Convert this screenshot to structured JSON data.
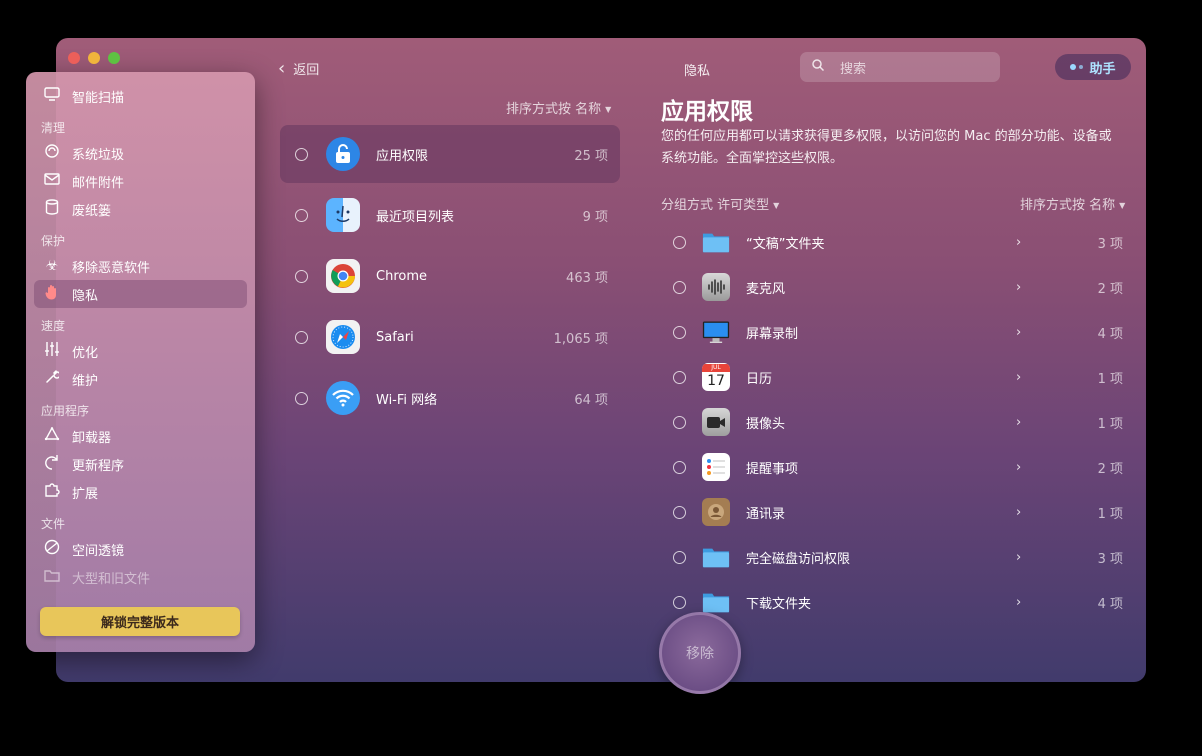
{
  "window": {
    "title": "隐私"
  },
  "header": {
    "back_label": "返回",
    "search_placeholder": "搜索",
    "assistant_label": "助手"
  },
  "sidebar": {
    "smart_scan": "智能扫描",
    "sections": {
      "cleanup": "清理",
      "protection": "保护",
      "speed": "速度",
      "applications": "应用程序",
      "files": "文件"
    },
    "items": {
      "system_junk": "系统垃圾",
      "mail_attachments": "邮件附件",
      "trash_bins": "废纸篓",
      "malware_removal": "移除恶意软件",
      "privacy": "隐私",
      "optimization": "优化",
      "maintenance": "维护",
      "uninstaller": "卸载器",
      "updater": "更新程序",
      "extensions": "扩展",
      "space_lens": "空间透镜",
      "large_old_files": "大型和旧文件"
    },
    "unlock_label": "解锁完整版本"
  },
  "middle": {
    "sort_label": "排序方式按 名称",
    "apps": [
      {
        "name": "应用权限",
        "count": "25 项",
        "icon": "lock-icon"
      },
      {
        "name": "最近项目列表",
        "count": "9 项",
        "icon": "finder-icon"
      },
      {
        "name": "Chrome",
        "count": "463 项",
        "icon": "chrome-icon"
      },
      {
        "name": "Safari",
        "count": "1,065 项",
        "icon": "safari-icon"
      },
      {
        "name": "Wi-Fi 网络",
        "count": "64 项",
        "icon": "wifi-icon"
      }
    ]
  },
  "detail": {
    "title": "应用权限",
    "description": "您的任何应用都可以请求获得更多权限，以访问您的 Mac 的部分功能、设备或系统功能。全面掌控这些权限。",
    "group_label": "分组方式  许可类型",
    "sort_label": "排序方式按 名称",
    "permissions": [
      {
        "name": "“文稿”文件夹",
        "count": "3 项",
        "icon": "folder-icon"
      },
      {
        "name": "麦克风",
        "count": "2 项",
        "icon": "microphone-icon"
      },
      {
        "name": "屏幕录制",
        "count": "4 项",
        "icon": "display-icon"
      },
      {
        "name": "日历",
        "count": "1 项",
        "icon": "calendar-icon",
        "calendar_month": "JUL",
        "calendar_day": "17"
      },
      {
        "name": "摄像头",
        "count": "1 项",
        "icon": "camera-icon"
      },
      {
        "name": "提醒事项",
        "count": "2 项",
        "icon": "reminders-icon"
      },
      {
        "name": "通讯录",
        "count": "1 项",
        "icon": "contacts-icon"
      },
      {
        "name": "完全磁盘访问权限",
        "count": "3 项",
        "icon": "folder-icon"
      },
      {
        "name": "下载文件夹",
        "count": "4 项",
        "icon": "folder-icon"
      }
    ]
  },
  "remove_label": "移除"
}
